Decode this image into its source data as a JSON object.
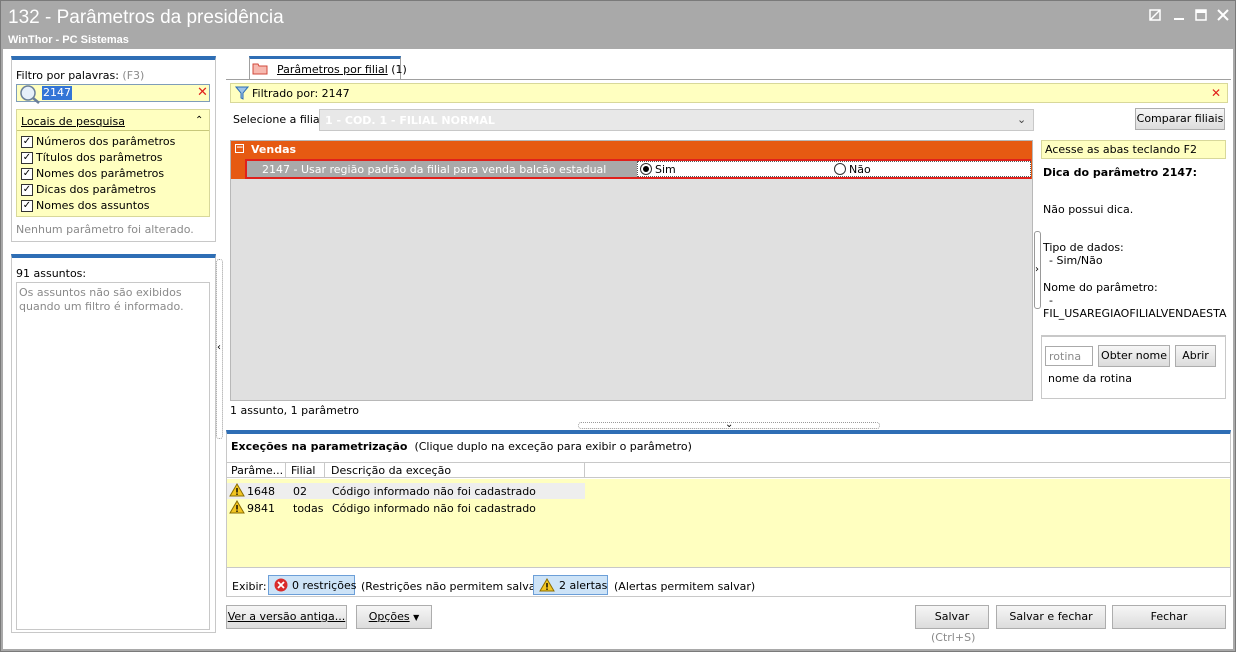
{
  "window": {
    "title": "132 - Parâmetros da presidência",
    "subtitle": "WinThor - PC Sistemas"
  },
  "filter_panel": {
    "label": "Filtro por palavras:",
    "shortcut": "(F3)",
    "search_value": "2147",
    "locais_title": "Locais de pesquisa",
    "options": [
      {
        "label": "Números dos parâmetros",
        "checked": true
      },
      {
        "label": "Títulos dos parâmetros",
        "checked": true
      },
      {
        "label": "Nomes dos parâmetros",
        "checked": true
      },
      {
        "label": "Dicas dos parâmetros",
        "checked": true
      },
      {
        "label": "Nomes dos assuntos",
        "checked": true
      }
    ],
    "status": "Nenhum parâmetro foi alterado."
  },
  "subjects_panel": {
    "count_label": "91 assuntos:",
    "info": "Os assuntos não são exibidos quando um filtro é informado."
  },
  "tab": {
    "label": "Parâmetros por filial",
    "count": "(1)"
  },
  "filter_bar": {
    "text": "Filtrado por: 2147"
  },
  "branch": {
    "label": "Selecione a filial:",
    "value": "1 - COD. 1 - FILIAL NORMAL",
    "compare_button": "Comparar filiais"
  },
  "params": {
    "group": "Vendas",
    "row_label": "2147 - Usar região padrão da filial para venda balcão estadual",
    "option_yes": "Sim",
    "option_no": "Não",
    "selected": "Sim",
    "summary": "1 assunto, 1 parâmetro"
  },
  "tip_panel": {
    "hint": "Acesse as abas teclando F2",
    "title": "Dica do parâmetro 2147:",
    "body": "Não possui dica.",
    "type_label": "Tipo de dados:",
    "type_value": "- Sim/Não",
    "name_label": "Nome do parâmetro:",
    "name_dash": "-",
    "name_value": "FIL_USAREGIAOFILIALVENDAESTADU"
  },
  "routine": {
    "placeholder": "rotina",
    "get_name_button": "Obter nome",
    "open_button": "Abrir",
    "name_label": "nome da rotina"
  },
  "exceptions": {
    "title": "Exceções na parametrização",
    "hint": "(Clique duplo na exceção para exibir o parâmetro)",
    "columns": [
      "Parâme...",
      "Filial",
      "Descrição da exceção"
    ],
    "rows": [
      {
        "param": "1648",
        "filial": "02",
        "desc": "Código informado não foi cadastrado"
      },
      {
        "param": "9841",
        "filial": "todas",
        "desc": "Código informado não foi cadastrado"
      }
    ],
    "show_label": "Exibir:",
    "restrictions_button": "0 restrições",
    "restrictions_note": "(Restrições não permitem salvar)",
    "alerts_button": "2 alertas",
    "alerts_note": "(Alertas permitem salvar)"
  },
  "footer": {
    "old_version_button": "Ver a versão antiga...",
    "options_button": "Opções",
    "save_button": "Salvar",
    "save_shortcut": "(Ctrl+S)",
    "save_close_button": "Salvar e fechar",
    "close_button": "Fechar"
  },
  "colors": {
    "accent_blue": "#2e6eb5",
    "group_orange": "#e65a12",
    "highlight_red": "#e0201b",
    "tip_yellow": "#ffffc0"
  }
}
